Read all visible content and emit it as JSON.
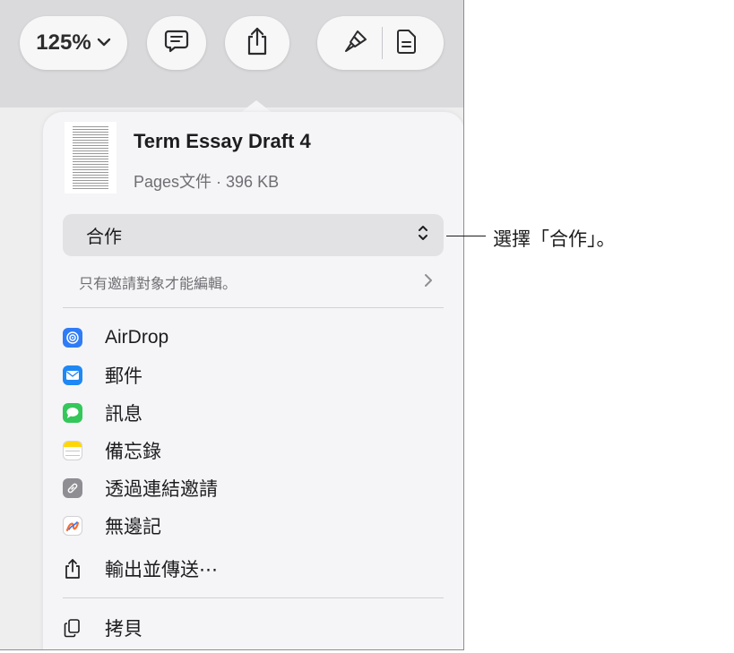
{
  "toolbar": {
    "zoom_label": "125%",
    "zoom_icon": "chevron-down-icon",
    "comment_icon": "comment-icon",
    "share_icon": "share-icon",
    "format_icon": "paintbrush-icon",
    "document_icon": "document-icon"
  },
  "share_popover": {
    "document": {
      "title": "Term Essay Draft 4",
      "subtitle": "Pages文件 · 396 KB"
    },
    "collaborate_select": {
      "value": "合作"
    },
    "permission_text": "只有邀請對象才能編輯。",
    "options": [
      {
        "label": "AirDrop",
        "icon": "airdrop-icon",
        "color": "#2f7cf6"
      },
      {
        "label": "郵件",
        "icon": "mail-icon",
        "color": "#1e88f5"
      },
      {
        "label": "訊息",
        "icon": "messages-icon",
        "color": "#34c759"
      },
      {
        "label": "備忘錄",
        "icon": "notes-icon",
        "color": "#ffd60a"
      },
      {
        "label": "透過連結邀請",
        "icon": "link-icon",
        "color": "#8e8e93"
      },
      {
        "label": "無邊記",
        "icon": "freeform-icon",
        "color": "#f5f5f7"
      },
      {
        "label": "輸出並傳送⋯",
        "icon": "export-icon"
      },
      {
        "label": "拷貝",
        "icon": "copy-icon"
      }
    ]
  },
  "callout": {
    "text": "選擇「合作」。"
  }
}
